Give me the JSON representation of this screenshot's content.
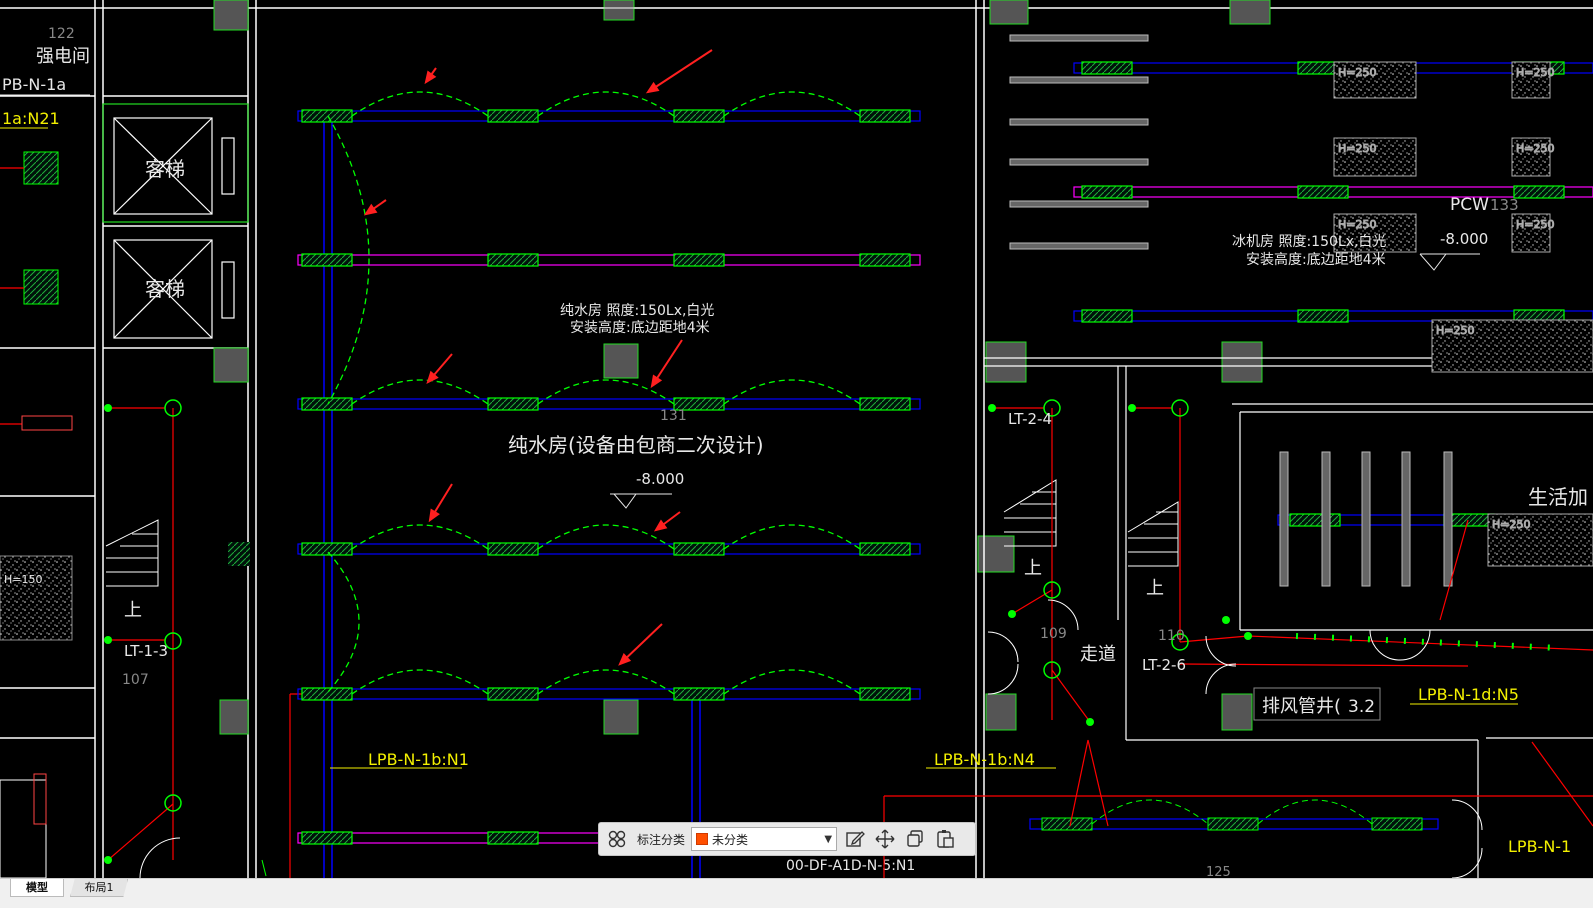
{
  "drawing": {
    "labels": {
      "strong_room_no": "122",
      "strong_room": "强电间",
      "panel_1a": "PB-N-1a",
      "circuit_1a": "1a:N21",
      "elevator": "客梯",
      "up": "上",
      "lt13": "LT-1-3",
      "room107": "107",
      "h150": "H=150",
      "pure_water_spec1": "纯水房  照度:150Lx,白光",
      "pure_water_spec2": "安装高度:底边距地4米",
      "room131": "131",
      "pure_water_room": "纯水房(设备由包商二次设计)",
      "level_minus8": "-8.000",
      "circuit_1b_n1": "LPB-N-1b:N1",
      "circuit_1b_n4": "LPB-N-1b:N4",
      "pcw": "PCW",
      "room133": "133",
      "ice_room_spec1": "冰机房  照度:150Lx,白光",
      "ice_room_spec2": "安装高度:底边距地4米",
      "h250": "H=250",
      "lt24": "LT-2-4",
      "room109": "109",
      "corridor": "走道",
      "room110": "110",
      "lt26": "LT-2-6",
      "exhaust_shaft": "排风管井(",
      "exhaust_no": "3.2",
      "circuit_1d_n5": "LPB-N-1d:N5",
      "circuit_1d_partial": "LPB-N-1",
      "domestic_partial": "生活加",
      "room125": "125",
      "bottom_partial": "00-DF-A1D-N-5:N1"
    },
    "colors": {
      "background": "#000000",
      "wall": "#ffffff",
      "fixture": "#00ff00",
      "circuit_wire": "#0000ff",
      "magenta_wire": "#ff00ff",
      "red_wire": "#ff0000",
      "arrow": "#ff2020",
      "text_white": "#e8e8e8",
      "text_yellow": "#f3f000"
    }
  },
  "toolbar": {
    "grid_icon": "grid-icon",
    "category_label": "标注分类",
    "category_value": "未分类",
    "category_color": "#ff4f00",
    "edit_icon": "edit-icon",
    "move_icon": "move-icon",
    "copy_icon": "copy-icon",
    "paste_icon": "paste-icon"
  },
  "tabs": {
    "model": "模型",
    "layout": "布局1"
  }
}
